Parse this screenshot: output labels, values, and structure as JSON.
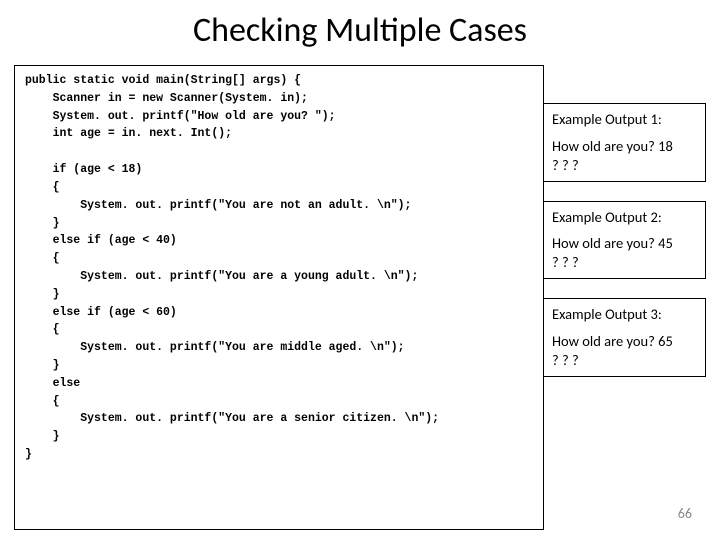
{
  "title": "Checking Multiple Cases",
  "code": "public static void main(String[] args) {\n    Scanner in = new Scanner(System. in);\n    System. out. printf(\"How old are you? \");\n    int age = in. next. Int();\n\n    if (age < 18)\n    {\n        System. out. printf(\"You are not an adult. \\n\");\n    }\n    else if (age < 40)\n    {\n        System. out. printf(\"You are a young adult. \\n\");\n    }\n    else if (age < 60)\n    {\n        System. out. printf(\"You are middle aged. \\n\");\n    }\n    else\n    {\n        System. out. printf(\"You are a senior citizen. \\n\");\n    }\n}",
  "examples": [
    {
      "label": "Example Output 1:",
      "body": "How old are you? 18\n? ? ?"
    },
    {
      "label": "Example Output 2:",
      "body": "How old are you? 45\n? ? ?"
    },
    {
      "label": "Example Output 3:",
      "body": "How old are you? 65\n? ? ?"
    }
  ],
  "page_number": "66"
}
